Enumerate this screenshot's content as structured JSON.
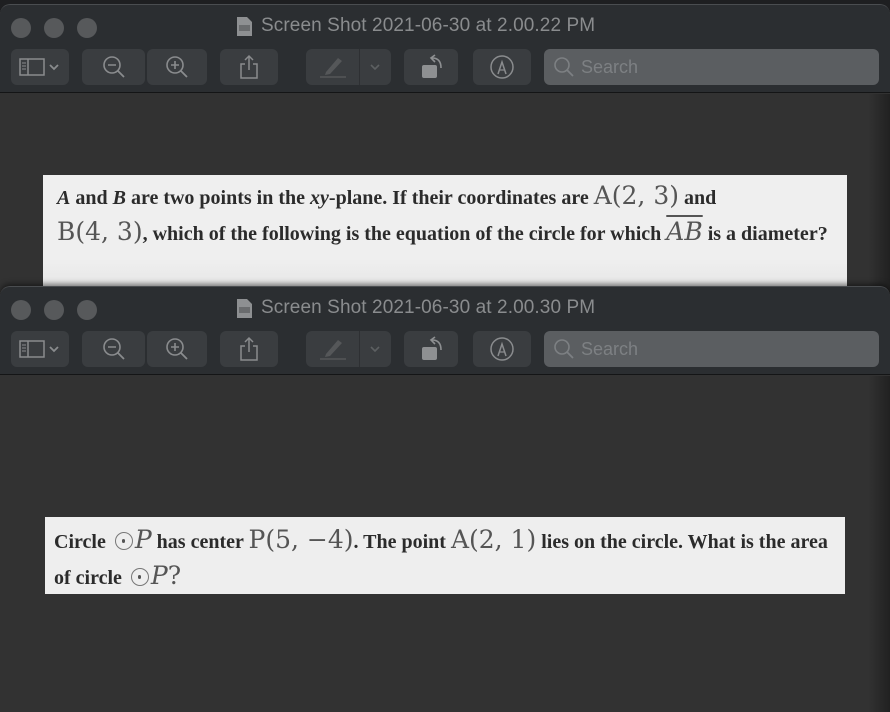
{
  "windows": [
    {
      "title": "Screen Shot 2021-06-30 at 2.00.22 PM",
      "toolbar": {
        "search_placeholder": "Search",
        "buttons": [
          "sidebar-toggle",
          "zoom-out",
          "zoom-in",
          "share",
          "highlight",
          "highlight-menu",
          "rotate",
          "markup"
        ]
      },
      "question": {
        "parts": {
          "a1": "A",
          "t1": " and ",
          "b1": "B",
          "t2": " are two points in the ",
          "xy": "xy",
          "t3": "-plane. If their coordinates are ",
          "pointA": "A(2, 3)",
          "t4": " and",
          "pointB": "B(4, 3)",
          "t5": ", which of the following is the equation of the circle for which ",
          "seg": "AB",
          "t6": " is a diameter?"
        }
      }
    },
    {
      "title": "Screen Shot 2021-06-30 at 2.00.30 PM",
      "toolbar": {
        "search_placeholder": "Search"
      },
      "question": {
        "parts": {
          "t1": "Circle ",
          "p1": "P",
          "t2": " has center ",
          "center": "P(5, −4)",
          "t3": ". The point ",
          "pointA": "A(2, 1)",
          "t4": " lies on the circle. What is the area of circle ",
          "p2": "P",
          "t5": "?"
        }
      }
    }
  ],
  "colors": {
    "titlebar": "#2b2e31",
    "canvas": "#323232",
    "page": "#eeeeee",
    "button": "#3a3d40",
    "search": "#5b5e61"
  }
}
